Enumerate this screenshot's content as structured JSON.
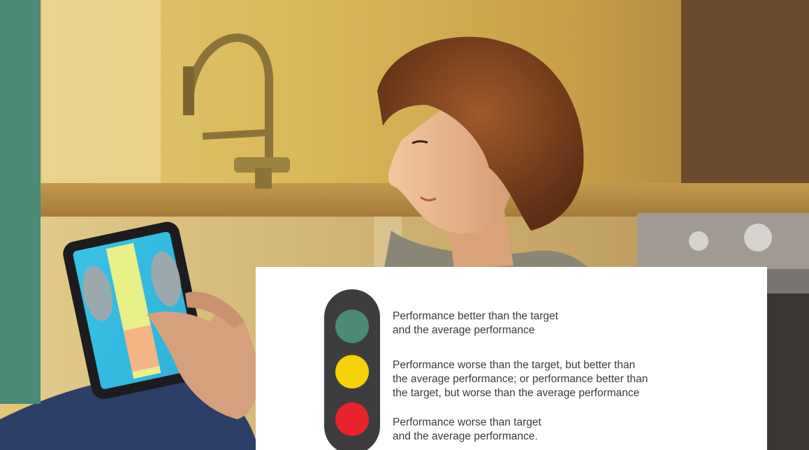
{
  "colors": {
    "accent_bar": "#4a8a76",
    "panel_background": "#ffffff",
    "traffic_light_body": "#3d3d3f",
    "green": "#4a8a76",
    "yellow": "#f5d20a",
    "red": "#e8232a"
  },
  "legend": {
    "items": [
      {
        "color": "green",
        "lines": [
          "Performance better than the target",
          "and the average performance"
        ]
      },
      {
        "color": "yellow",
        "lines": [
          "Performance worse than the target, but better than",
          "the average performance; or performance better than",
          "the target, but worse than the average performance"
        ]
      },
      {
        "color": "red",
        "lines": [
          "Performance worse than target",
          "and the average performance."
        ]
      }
    ]
  }
}
